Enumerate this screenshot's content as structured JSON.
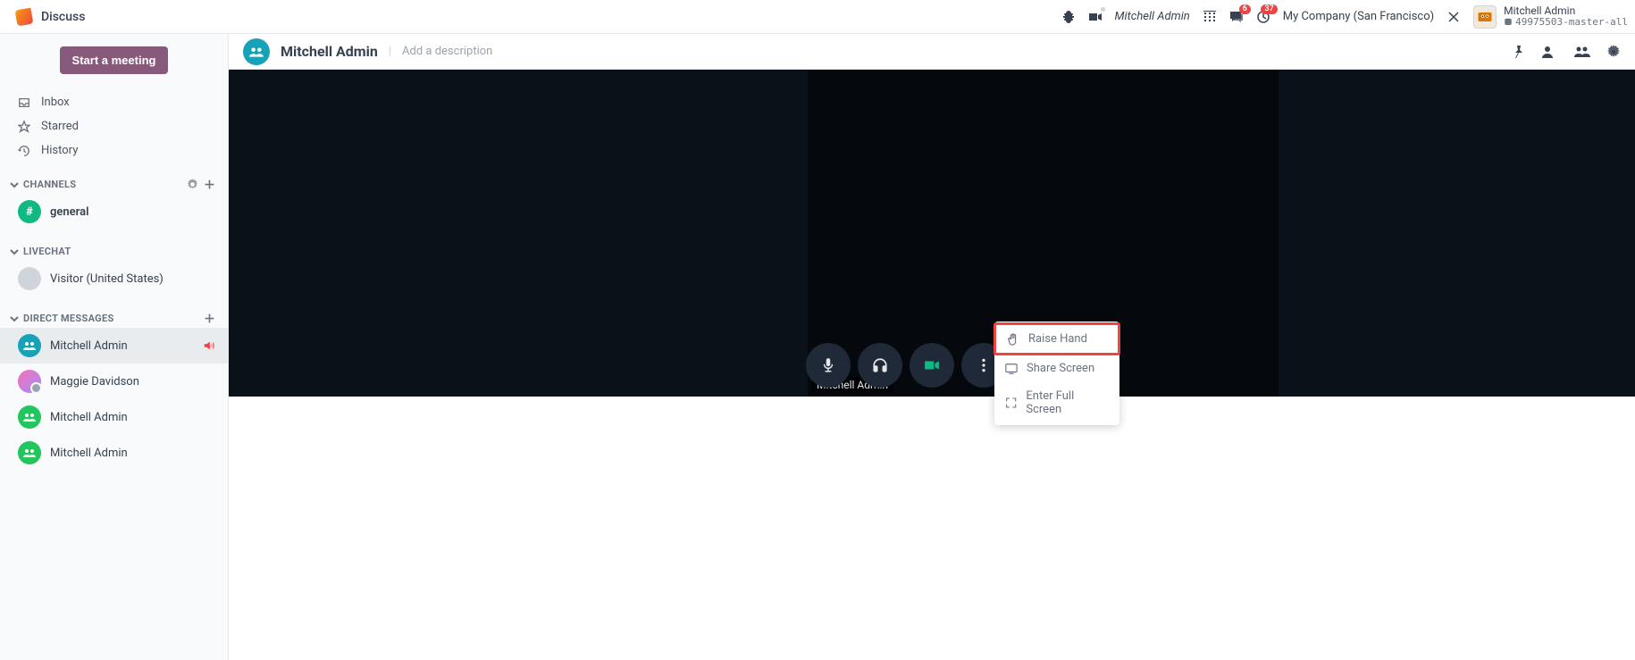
{
  "app": {
    "title": "Discuss"
  },
  "topbar": {
    "username": "Mitchell Admin",
    "company": "My Company (San Francisco)",
    "messages_badge": "6",
    "activities_badge": "37",
    "user": {
      "name": "Mitchell Admin",
      "db": "49975503-master-all"
    }
  },
  "sidebar": {
    "start_meeting": "Start a meeting",
    "inbox": "Inbox",
    "starred": "Starred",
    "history": "History",
    "channels_label": "CHANNELS",
    "livechat_label": "LIVECHAT",
    "dm_label": "DIRECT MESSAGES",
    "channels": [
      {
        "name": "general"
      }
    ],
    "livechats": [
      {
        "name": "Visitor (United States)"
      }
    ],
    "dms": [
      {
        "name": "Mitchell Admin",
        "active": true,
        "speaking": true,
        "group": true
      },
      {
        "name": "Maggie Davidson",
        "photo": true
      },
      {
        "name": "Mitchell Admin",
        "group": true
      },
      {
        "name": "Mitchell Admin",
        "group": true
      }
    ]
  },
  "thread": {
    "title": "Mitchell Admin",
    "add_description": "Add a description"
  },
  "call": {
    "tile_name": "Mitchell Admin",
    "menu": {
      "raise_hand": "Raise Hand",
      "share_screen": "Share Screen",
      "fullscreen": "Enter Full Screen"
    }
  }
}
